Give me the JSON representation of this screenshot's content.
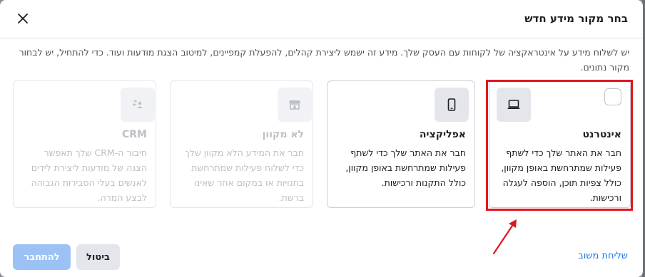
{
  "dialog": {
    "title": "בחר מקור מידע חדש",
    "description": "יש לשלוח מידע על אינטראקציה של לקוחות עם העסק שלך. מידע זה ישמש ליצירת קהלים, להפעלת קמפיינים, למיטוב הצגת מודעות ועוד. כדי להתחיל, יש לבחור מקור נתונים."
  },
  "cards": [
    {
      "title": "אינטרנט",
      "text": "חבר את האתר שלך כדי לשתף פעילות שמתרחשת באופן מקוון, כולל צפיות תוכן, הוספה לעגלה ורכישות.",
      "icon": "laptop-icon",
      "disabled": false,
      "highlighted": true
    },
    {
      "title": "אפליקציה",
      "text": "חבר את האתר שלך כדי לשתף פעילות שמתרחשת באופן מקוון, כולל התקנות ורכישות.",
      "icon": "mobile-phone-icon",
      "disabled": false
    },
    {
      "title": "לא מקוון",
      "text": "חבר את המידע הלא מקוון שלך כדי לשלוח פעילות שמתרחשת בחנויות או במקום אחר שאינו ברשת.",
      "icon": "store-icon",
      "disabled": true
    },
    {
      "title": "CRM",
      "text": "חיבור ה-CRM שלך תאפשר הצגה של מודעות ליצירת לידים לאנשים בעלי הסבירות הגבוהה לבצע המרה.",
      "icon": "people-sync-icon",
      "disabled": true
    }
  ],
  "footer": {
    "feedback_link": "שליחת משוב",
    "cancel_label": "ביטול",
    "connect_label": "להתחבר"
  },
  "colors": {
    "accent": "#1b74e4",
    "connect_disabled": "#9cc2f5",
    "highlight_annotation": "#e0161f"
  }
}
